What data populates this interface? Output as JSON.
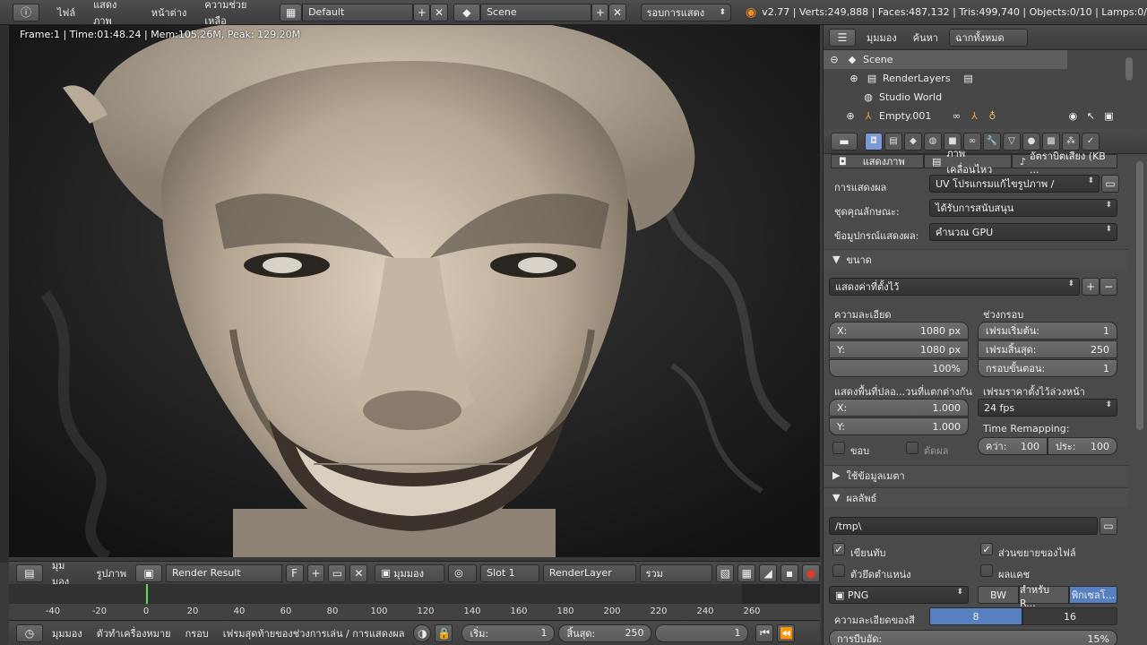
{
  "topbar": {
    "menus": [
      "ไฟล์",
      "แสดงภาพ",
      "หน้าต่าง",
      "ความช่วยเหลือ"
    ],
    "layout": "Default",
    "scene": "Scene",
    "engine": "รอบการแสดง",
    "stats": "v2.77 | Verts:249,888 | Faces:487,132 | Tris:499,740 | Objects:0/10 | Lamps:0/"
  },
  "viewport": {
    "frame_info": "Frame:1 | Time:01:48.24 | Mem:105.26M, Peak: 129.20M"
  },
  "image_editor": {
    "view": "มุมมอง",
    "image": "รูปภาพ",
    "image_name": "Render Result",
    "fake_user": "F",
    "display": "มุมมอง",
    "slot": "Slot 1",
    "layer": "RenderLayer",
    "pass": "รวม"
  },
  "timeline": {
    "ticks": [
      -40,
      -20,
      0,
      20,
      40,
      60,
      80,
      100,
      120,
      140,
      160,
      180,
      200,
      220,
      240,
      260
    ],
    "header": {
      "view": "มุมมอง",
      "marker": "ตัวทำเครื่องหมาย",
      "frame": "กรอบ",
      "playback": "เฟรมสุดท้ายของช่วงการเล่น / การแสดงผล",
      "start_label": "เริ่ม:",
      "start": "1",
      "end_label": "สิ้นสุด:",
      "end": "250",
      "current": "1"
    }
  },
  "outliner": {
    "view": "มุมมอง",
    "search": "ค้นหา",
    "filter": "ฉากทั้งหมด",
    "rows": [
      {
        "label": "Scene"
      },
      {
        "label": "RenderLayers"
      },
      {
        "label": "Studio World"
      },
      {
        "label": "Empty.001"
      }
    ]
  },
  "properties": {
    "subtabs": [
      "แสดงภาพ",
      "ภาพเคลื่อนไหว",
      "อัตราบิตเสียง (KB ..."
    ],
    "display_label": "การแสดงผล",
    "display_value": "UV โปรแกรมแก้ไขรูปภาพ /",
    "feature_label": "ชุดคุณลักษณะ:",
    "feature_value": "ได้รับการสนับสนุน",
    "device_label": "ข้อมูปกรณ์แสดงผล:",
    "device_value": "คำนวณ GPU",
    "dimensions_header": "ขนาด",
    "preset": "แสดงค่าที่ตั้งไว้",
    "resolution_label": "ความละเอียด",
    "res_x_label": "X:",
    "res_x": "1080 px",
    "res_y_label": "Y:",
    "res_y": "1080 px",
    "res_pct": "100%",
    "frame_range_label": "ช่วงกรอบ",
    "start_label": "เฟรมเริ่มต้น:",
    "start": "1",
    "end_label": "เฟรมสิ้นสุด:",
    "end": "250",
    "step_label": "กรอบขั้นตอน:",
    "step": "1",
    "aspect_label": "แสดงพื้นที่ปลอ...วนที่แตกต่างกัน",
    "asp_x_label": "X:",
    "asp_x": "1.000",
    "asp_y_label": "Y:",
    "asp_y": "1.000",
    "border_label": "ขอบ",
    "crop_label": "ตัดผล",
    "fps_label": "เฟรมราคาตั้งไว้ล่วงหน้า",
    "fps": "24 fps",
    "remap_label": "Time Remapping:",
    "remap_old_label": "คว่า:",
    "remap_old": "100",
    "remap_new_label": "ประ:",
    "remap_new": "100",
    "metadata_header": "ใช้ข้อมูลเมตา",
    "output_header": "ผลลัพธ์",
    "output_path": "/tmp\\",
    "overwrite_label": "เขียนทับ",
    "extensions_label": "ส่วนขยายของไฟล์",
    "placeholders_label": "ตัวยึดตำแหน่ง",
    "cache_label": "ผลแคช",
    "format": "PNG",
    "bw": "BW",
    "rgb": "สำหรับ R...",
    "rgba": "พิกเซลโ...",
    "depth_label": "ความละเอียดของสี",
    "depth_8": "8",
    "depth_16": "16",
    "compress_label": "การบีบอัด:",
    "compress": "15%"
  }
}
